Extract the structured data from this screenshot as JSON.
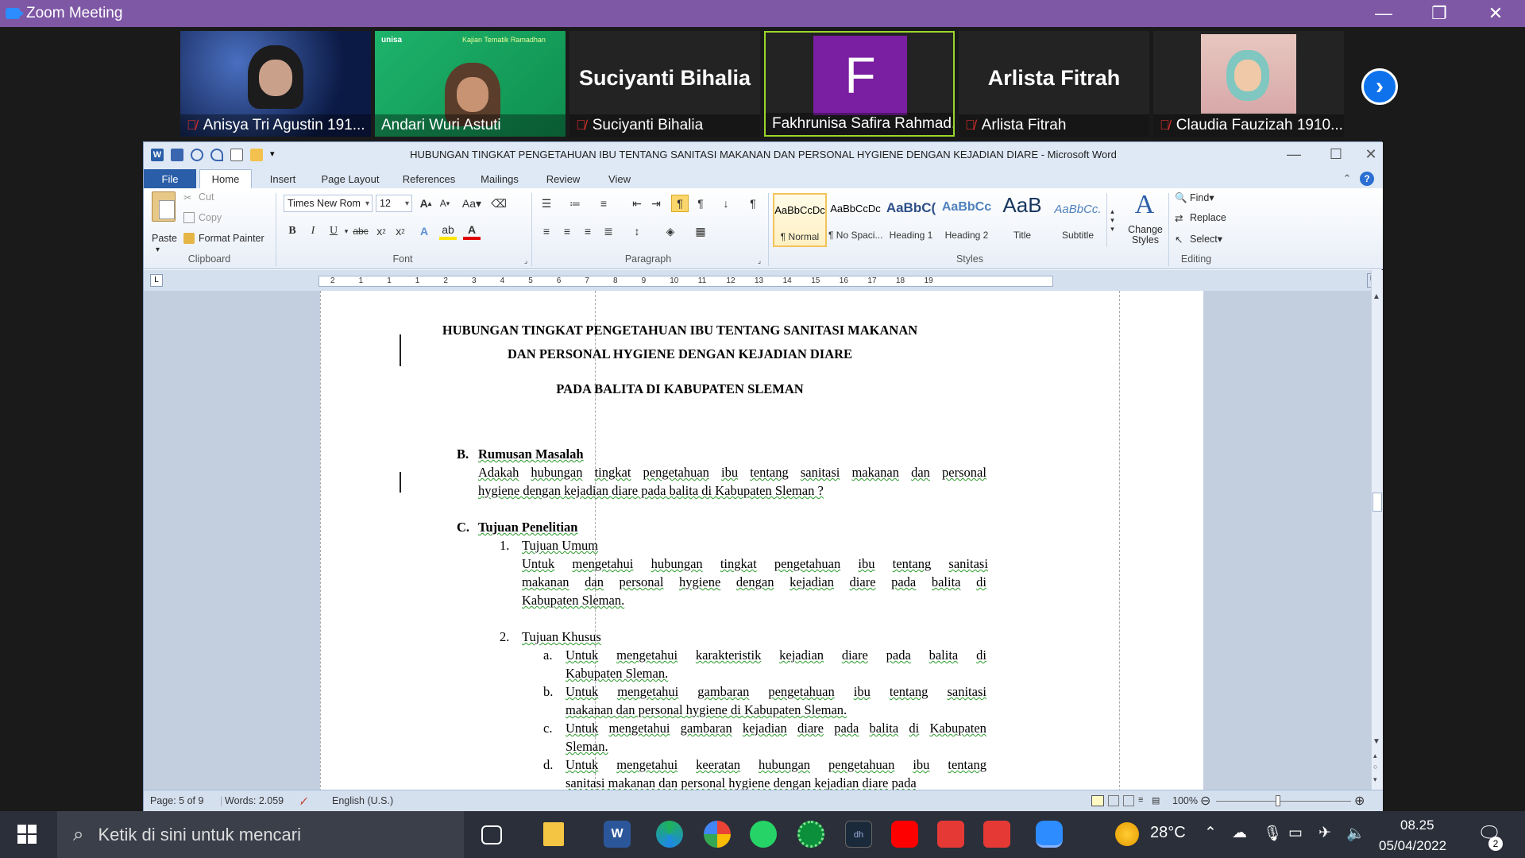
{
  "zoom": {
    "title": "Zoom Meeting",
    "participants": [
      {
        "name": "Anisya Tri Agustin 191...",
        "muted": true,
        "big_name": ""
      },
      {
        "name": "Andari Wuri Astuti",
        "muted": false,
        "big_name": ""
      },
      {
        "name": "Suciyanti Bihalia",
        "muted": true,
        "big_name": "Suciyanti Bihalia"
      },
      {
        "name": "Fakhrunisa Safira Rahmad...",
        "muted": false,
        "big_name": "",
        "avatar_letter": "F",
        "avatar_color": "#7b1fa2"
      },
      {
        "name": "Arlista Fitrah",
        "muted": true,
        "big_name": "Arlista Fitrah"
      },
      {
        "name": "Claudia Fauzizah 1910...",
        "muted": true,
        "big_name": ""
      }
    ],
    "slide_text_1": "unisa",
    "slide_text_2": "Kajian Tematik Ramadhan"
  },
  "word": {
    "window_title": "HUBUNGAN TINGKAT PENGETAHUAN IBU TENTANG SANITASI MAKANAN DAN PERSONAL HYGIENE DENGAN KEJADIAN DIARE  -  Microsoft Word",
    "tabs": [
      "File",
      "Home",
      "Insert",
      "Page Layout",
      "References",
      "Mailings",
      "Review",
      "View"
    ],
    "clipboard": {
      "paste": "Paste",
      "cut": "Cut",
      "copy": "Copy",
      "format_painter": "Format Painter",
      "label": "Clipboard"
    },
    "font": {
      "name": "Times New Rom",
      "size": "12",
      "label": "Font"
    },
    "paragraph_label": "Paragraph",
    "styles": [
      {
        "preview": "AaBbCcDc",
        "name": "¶ Normal"
      },
      {
        "preview": "AaBbCcDc",
        "name": "¶ No Spaci..."
      },
      {
        "preview": "AaBbC(",
        "name": "Heading 1"
      },
      {
        "preview": "AaBbCc",
        "name": "Heading 2"
      },
      {
        "preview": "AaB",
        "name": "Title"
      },
      {
        "preview": "AaBbCc.",
        "name": "Subtitle"
      }
    ],
    "styles_label": "Styles",
    "change_styles": "Change Styles",
    "editing": {
      "find": "Find",
      "replace": "Replace",
      "select": "Select",
      "label": "Editing"
    },
    "ruler_numbers": [
      "2",
      "1",
      "1",
      "1",
      "2",
      "3",
      "4",
      "5",
      "6",
      "7",
      "8",
      "9",
      "10",
      "11",
      "12",
      "13",
      "14",
      "15",
      "16",
      "17",
      "18",
      "19"
    ],
    "document": {
      "title_1": "HUBUNGAN TINGKAT PENGETAHUAN IBU TENTANG SANITASI MAKANAN",
      "title_2": "DAN PERSONAL HYGIENE DENGAN KEJADIAN DIARE",
      "title_3": "PADA BALITA DI KABUPATEN SLEMAN",
      "b_marker": "B.",
      "b_heading": "Rumusan Masalah",
      "b_line1": [
        "Adakah",
        "hubungan",
        "tingkat",
        "pengetahuan",
        "ibu",
        "tentang",
        "sanitasi",
        "makanan",
        "dan",
        "personal"
      ],
      "b_line2": "hygiene dengan kejadian diare pada balita di Kabupaten Sleman ?",
      "c_marker": "C.",
      "c_heading": "Tujuan Penelitian",
      "c1_marker": "1.",
      "c1_heading": "Tujuan Umum",
      "c1_line1": [
        "Untuk",
        "mengetahui",
        "hubungan",
        "tingkat",
        "pengetahuan",
        "ibu",
        "tentang",
        "sanitasi"
      ],
      "c1_line2": [
        "makanan",
        "dan",
        "personal",
        "hygiene",
        "dengan",
        "kejadian",
        "diare",
        "pada",
        "balita",
        "di"
      ],
      "c1_line3": "Kabupaten Sleman.",
      "c2_marker": "2.",
      "c2_heading": "Tujuan Khusus",
      "a_marker": "a.",
      "a_line1": [
        "Untuk",
        "mengetahui",
        "karakteristik",
        "kejadian",
        "diare",
        "pada",
        "balita",
        "di"
      ],
      "a_line2": "Kabupaten Sleman.",
      "b2_marker": "b.",
      "b2_line1": [
        "Untuk",
        "mengetahui",
        "gambaran",
        "pengetahuan",
        "ibu",
        "tentang",
        "sanitasi"
      ],
      "b2_line2": "makanan dan personal hygiene di Kabupaten Sleman.",
      "c3_marker": "c.",
      "c3_line1": [
        "Untuk",
        "mengetahui",
        "gambaran",
        "kejadian",
        "diare",
        "pada",
        "balita",
        "di",
        "Kabupaten"
      ],
      "c3_line2": "Sleman.",
      "d_marker": "d.",
      "d_line1": [
        "Untuk",
        "mengetahui",
        "keeratan",
        "hubungan",
        "pengetahuan",
        "ibu",
        "tentang"
      ],
      "d_line2": "sanitasi makanan dan personal hygiene dengan kejadian diare pada"
    },
    "status": {
      "page": "Page: 5 of 9",
      "words": "Words: 2.059",
      "language": "English (U.S.)",
      "zoom": "100%"
    }
  },
  "taskbar": {
    "search_placeholder": "Ketik di sini untuk mencari",
    "weather": "28°C",
    "time": "08.25",
    "date": "05/04/2022",
    "notifications": "2"
  }
}
